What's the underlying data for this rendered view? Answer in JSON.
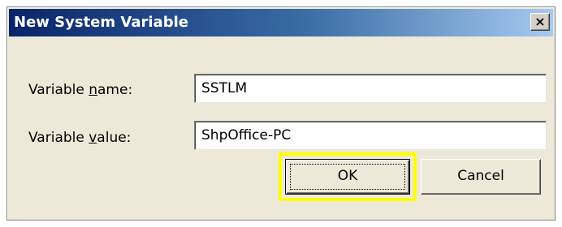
{
  "dialog": {
    "title": "New System Variable",
    "close_glyph": "×",
    "close_icon": "close-icon"
  },
  "fields": {
    "name": {
      "label_pre": "Variable ",
      "label_accel": "n",
      "label_post": "ame:",
      "value": "SSTLM"
    },
    "value": {
      "label_pre": "Variable ",
      "label_accel": "v",
      "label_post": "alue:",
      "value": "ShpOffice-PC"
    }
  },
  "buttons": {
    "ok_label": "OK",
    "cancel_label": "Cancel"
  },
  "colors": {
    "title_gradient_start": "#0a246a",
    "title_gradient_end": "#a6caf0",
    "dialog_bg": "#ece9d8",
    "highlight": "#ffff00"
  }
}
